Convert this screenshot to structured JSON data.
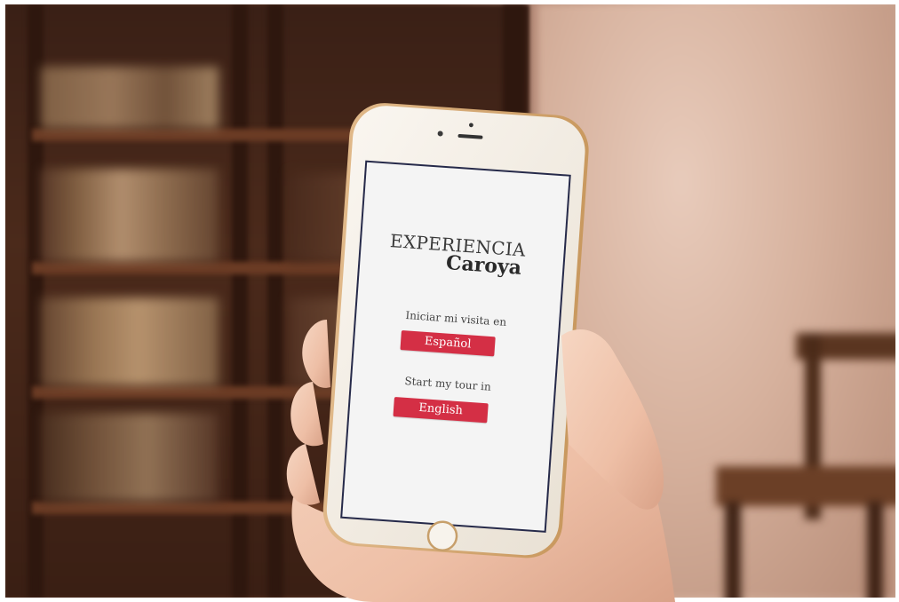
{
  "app": {
    "brand_line1": "EXPERIENCIA",
    "brand_line2": "Caroya"
  },
  "spanish": {
    "prompt": "Iniciar mi visita en",
    "button_label": "Español"
  },
  "english": {
    "prompt": "Start my tour in",
    "button_label": "English"
  },
  "colors": {
    "accent": "#d42f45",
    "screen_background": "#f4f4f4",
    "phone_body": "#f3efe8"
  },
  "icons": {
    "home_button": "home-button-icon",
    "front_camera": "front-camera-icon",
    "speaker": "speaker-icon"
  }
}
